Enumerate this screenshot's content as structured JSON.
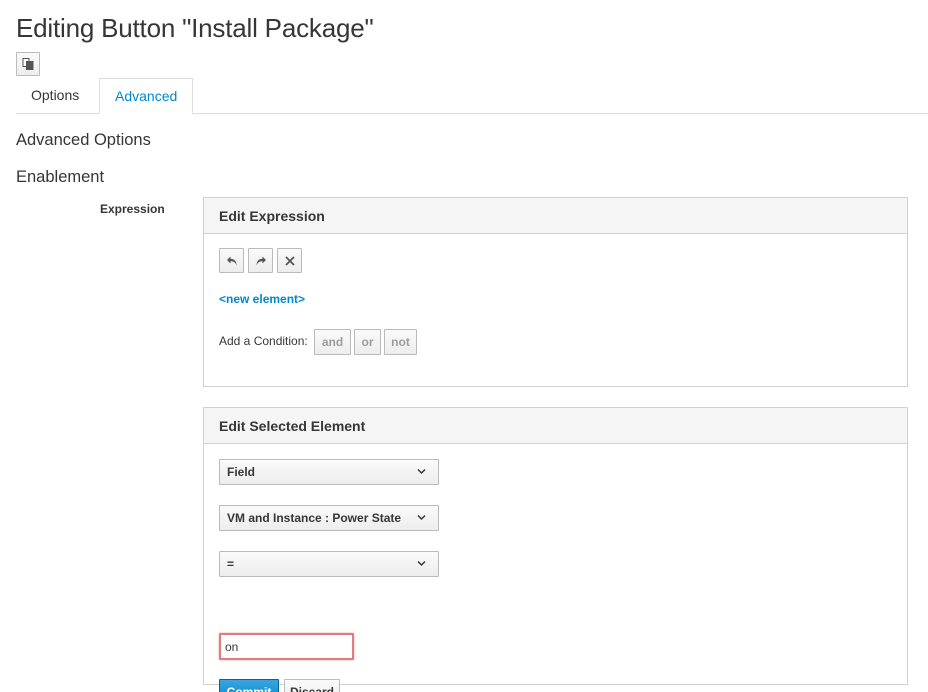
{
  "page": {
    "title": "Editing Button \"Install Package\""
  },
  "toolbar": {
    "copy_icon": "copy-icon"
  },
  "tabs": [
    {
      "label": "Options",
      "active": false
    },
    {
      "label": "Advanced",
      "active": true
    }
  ],
  "advanced": {
    "heading": "Advanced Options",
    "enablement_heading": "Enablement",
    "expression_label": "Expression"
  },
  "edit_expression": {
    "title": "Edit Expression",
    "icons": [
      "undo-icon",
      "redo-icon",
      "remove-icon"
    ],
    "new_element_link": "<new element>",
    "add_condition_label": "Add a Condition:",
    "conditions": [
      "and",
      "or",
      "not"
    ]
  },
  "edit_selected": {
    "title": "Edit Selected Element",
    "type_select": "Field",
    "field_select": "VM and Instance : Power State",
    "operator_select": "=",
    "value_input": "on",
    "commit_label": "Commit",
    "discard_label": "Discard"
  },
  "colors": {
    "accent": "#0088ce",
    "input_error_border": "#e07b82"
  }
}
